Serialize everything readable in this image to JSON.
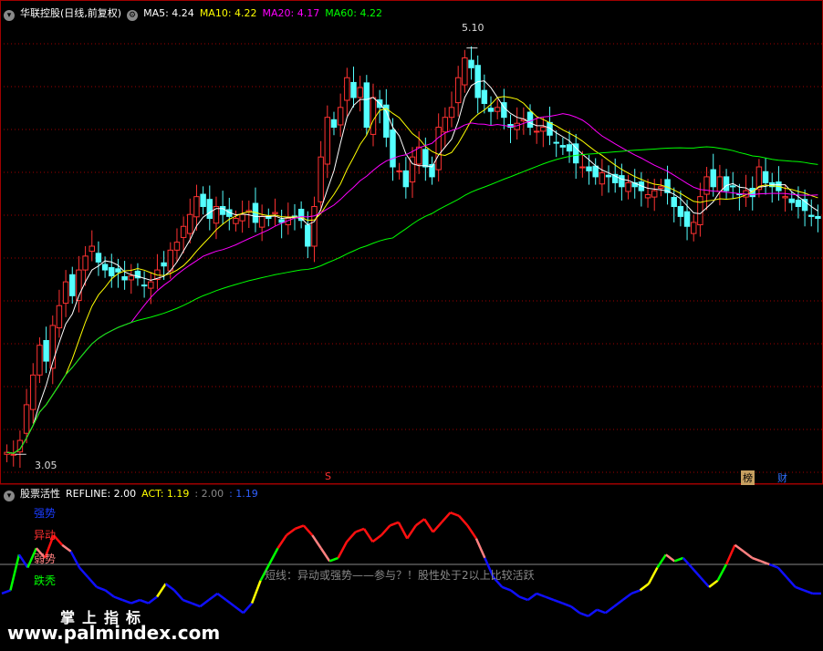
{
  "main_legend": {
    "stock": "华联控股(日线,前复权)",
    "ma5": "MA5: 4.24",
    "ma10": "MA10: 4.22",
    "ma20": "MA20: 4.17",
    "ma60": "MA60: 4.22"
  },
  "sub_legend": {
    "name": "股票活性",
    "refline": "REFLINE: 2.00",
    "act": "ACT: 1.19",
    "v2": ": 2.00",
    "v3": ": 1.19"
  },
  "labels": {
    "strong": "强势",
    "abnormal": "异动",
    "weak": "弱势",
    "decline": "跌秃",
    "high_price": "5.10",
    "low_price": "3.05",
    "marker_s": "S",
    "tag_bang": "榜",
    "tag_cai": "财"
  },
  "note": "短线：异动或强势——参与？！股性处于2以上比较活跃",
  "watermark": {
    "cn": "掌上指标",
    "url": "www.palmindex.com"
  },
  "colors": {
    "up": "#ff3232",
    "down": "#54ffff",
    "ma5": "#ffffff",
    "ma10": "#ffff00",
    "ma20": "#ff00ff",
    "ma60": "#00ff00",
    "act_blue": "#1010ff",
    "act_red": "#ff1010",
    "act_pink": "#ff8080",
    "act_yellow": "#ffff00",
    "act_green": "#00ff00"
  },
  "chart_data": [
    {
      "type": "candlestick",
      "series_labels": [
        "MA5",
        "MA10",
        "MA20",
        "MA60"
      ],
      "ylim": [
        2.95,
        5.25
      ],
      "closes": [
        3.06,
        3.05,
        3.12,
        3.3,
        3.45,
        3.6,
        3.52,
        3.7,
        3.8,
        3.92,
        3.85,
        3.98,
        4.05,
        4.1,
        4.02,
        3.98,
        3.95,
        3.97,
        3.93,
        3.95,
        3.94,
        3.9,
        3.92,
        3.98,
        4.0,
        4.08,
        4.12,
        4.2,
        4.26,
        4.35,
        4.3,
        4.24,
        4.3,
        4.26,
        4.25,
        4.24,
        4.26,
        4.28,
        4.22,
        4.25,
        4.24,
        4.27,
        4.22,
        4.24,
        4.25,
        4.23,
        4.1,
        4.3,
        4.55,
        4.75,
        4.7,
        4.8,
        4.95,
        4.85,
        4.9,
        4.7,
        4.85,
        4.8,
        4.65,
        4.5,
        4.48,
        4.4,
        4.55,
        4.6,
        4.5,
        4.45,
        4.7,
        4.75,
        4.8,
        4.95,
        5.05,
        5.0,
        4.85,
        4.82,
        4.78,
        4.8,
        4.75,
        4.7,
        4.72,
        4.74,
        4.7,
        4.68,
        4.7,
        4.66,
        4.62,
        4.6,
        4.58,
        4.52,
        4.5,
        4.48,
        4.45,
        4.47,
        4.45,
        4.42,
        4.4,
        4.42,
        4.4,
        4.38,
        4.36,
        4.38,
        4.4,
        4.37,
        4.3,
        4.25,
        4.2,
        4.22,
        4.35,
        4.45,
        4.4,
        4.45,
        4.38,
        4.4,
        4.36,
        4.38,
        4.35,
        4.5,
        4.42,
        4.4,
        4.38,
        4.35,
        4.32,
        4.3,
        4.28,
        4.25,
        4.24
      ],
      "annotations": [
        {
          "label": "5.10",
          "price": 5.1
        },
        {
          "label": "3.05",
          "price": 3.05
        }
      ]
    },
    {
      "type": "line",
      "title": "股票活性",
      "refline": 2.0,
      "act": [
        1.1,
        1.2,
        2.3,
        1.9,
        2.5,
        2.2,
        2.9,
        2.6,
        2.4,
        1.9,
        1.6,
        1.3,
        1.2,
        1.0,
        0.9,
        0.8,
        0.9,
        0.8,
        1.0,
        1.4,
        1.2,
        0.9,
        0.8,
        0.7,
        0.9,
        1.1,
        0.9,
        0.7,
        0.5,
        0.8,
        1.5,
        2.0,
        2.5,
        2.9,
        3.1,
        3.2,
        2.9,
        2.5,
        2.1,
        2.2,
        2.7,
        3.0,
        3.1,
        2.7,
        2.9,
        3.2,
        3.3,
        2.8,
        3.2,
        3.4,
        3.0,
        3.3,
        3.6,
        3.5,
        3.2,
        2.8,
        2.2,
        1.6,
        1.3,
        1.2,
        1.0,
        0.9,
        1.1,
        1.0,
        0.9,
        0.8,
        0.7,
        0.5,
        0.4,
        0.6,
        0.5,
        0.7,
        0.9,
        1.1,
        1.2,
        1.4,
        1.9,
        2.3,
        2.1,
        2.2,
        1.9,
        1.6,
        1.3,
        1.5,
        2.0,
        2.6,
        2.4,
        2.2,
        2.1,
        2.0,
        1.9,
        1.6,
        1.3,
        1.2,
        1.1,
        1.1
      ]
    }
  ]
}
